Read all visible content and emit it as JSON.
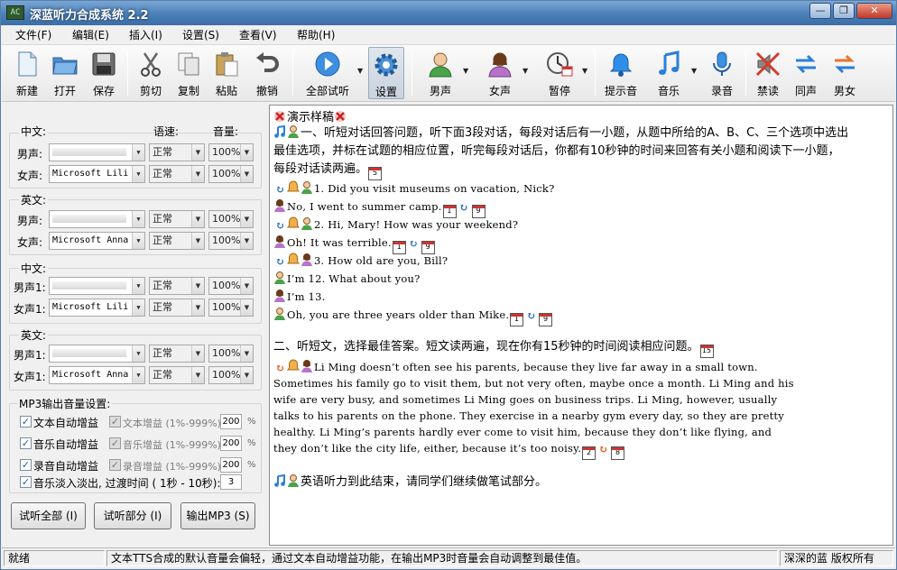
{
  "window": {
    "app_icon_text": "AC",
    "title": "深蓝听力合成系统 2.2",
    "min": "—",
    "max": "❐",
    "close": "✕"
  },
  "menu": [
    "文件(F)",
    "编辑(E)",
    "插入(I)",
    "设置(S)",
    "查看(V)",
    "帮助(H)"
  ],
  "toolbar": {
    "new": "新建",
    "open": "打开",
    "save": "保存",
    "cut": "剪切",
    "copy": "复制",
    "paste": "粘贴",
    "undo": "撤销",
    "play_all": "全部试听",
    "settings": "设置",
    "male": "男声",
    "female": "女声",
    "pause": "暂停",
    "prompt_tone": "提示音",
    "music": "音乐",
    "record": "录音",
    "no_read": "禁读",
    "same_voice": "同声",
    "male_female": "男女"
  },
  "left": {
    "sec1": {
      "title": "中文:",
      "speed": "语速:",
      "volume": "音量:",
      "rows": [
        {
          "label": "男声:",
          "voice": "",
          "speed": "正常",
          "volume": "100%"
        },
        {
          "label": "女声:",
          "voice": "Microsoft Lili",
          "speed": "正常",
          "volume": "100%"
        }
      ]
    },
    "sec2": {
      "title": "英文:",
      "rows": [
        {
          "label": "男声:",
          "voice": "",
          "speed": "正常",
          "volume": "100%"
        },
        {
          "label": "女声:",
          "voice": "Microsoft Anna",
          "speed": "正常",
          "volume": "100%"
        }
      ]
    },
    "sec3": {
      "title": "中文:",
      "rows": [
        {
          "label": "男声1:",
          "voice": "",
          "speed": "正常",
          "volume": "100%"
        },
        {
          "label": "女声1:",
          "voice": "Microsoft Lili",
          "speed": "正常",
          "volume": "100%"
        }
      ]
    },
    "sec4": {
      "title": "英文:",
      "rows": [
        {
          "label": "男声1:",
          "voice": "",
          "speed": "正常",
          "volume": "100%"
        },
        {
          "label": "女声1:",
          "voice": "Microsoft Anna",
          "speed": "正常",
          "volume": "100%"
        }
      ]
    },
    "mp3": {
      "title": "MP3输出音量设置:",
      "text_auto": "文本自动增益",
      "text_gain": "文本增益 (1%-999%)",
      "text_gain_val": "200",
      "music_auto": "音乐自动增益",
      "music_gain": "音乐增益 (1%-999%)",
      "music_gain_val": "200",
      "rec_auto": "录音自动增益",
      "rec_gain": "录音增益 (1%-999%)",
      "rec_gain_val": "200",
      "fade": "音乐淡入淡出, 过渡时间 ( 1秒 - 10秒):",
      "fade_val": "3",
      "pct": "%",
      "checked": "✓"
    },
    "buttons": {
      "play_all": "试听全部 (I)",
      "play_part": "试听部分 (I)",
      "export": "输出MP3 (S)"
    }
  },
  "doc": {
    "title": "演示样稿",
    "p1_a": "一、听短对话回答问题，听下面3段对话，每段对话后有一小题，从题中所给的A、B、C、三个选项中选出",
    "p1_b": "最佳选项，并标在试题的相应位置，听完每段对话后，你都有10秒钟的时间来回答有关小题和阅读下一小题，",
    "p1_c": "每段对话读两遍。",
    "p1_box": "5",
    "d1": "1. Did you visit museums on vacation, Nick?",
    "d2": "No, I went to summer camp.",
    "d3": "2. Hi, Mary! How was your weekend?",
    "d4": "Oh! It was terrible.",
    "d5": "3. How old are you, Bill?",
    "d6": "I’m 12.  What about you?",
    "d7": "I’m 13.",
    "d8": "Oh, you are three years older than Mike.",
    "box1": "1",
    "box9": "9",
    "loop": "↻",
    "p2": "二、听短文，选择最佳答案。短文读两遍，现在你有15秒钟的时间阅读相应问题。",
    "p2_box": "15",
    "t1": "Li Ming doesn’t often see his parents, because they live far away in a small town.",
    "t2": "Sometimes his family go to visit them, but not very often, maybe once a month.  Li Ming and his",
    "t3": "wife are very busy, and sometimes Li Ming goes on business trips.  Li Ming, however, usually",
    "t4": "talks to his parents on the phone.  They exercise in a nearby gym every day, so they are pretty",
    "t5": "healthy.  Li Ming’s parents hardly ever come to visit him, because they don’t like flying, and",
    "t6": "they don’t like the city life, either, because it’s too noisy.",
    "t_box2": "2",
    "t_box8": "8",
    "end": "英语听力到此结束，请同学们继续做笔试部分。"
  },
  "status": {
    "ready": "就绪",
    "message": "文本TTS合成的默认音量会偏轻，通过文本自动增益功能，在输出MP3时音量会自动调整到最佳值。",
    "copyright": "深深的蓝 版权所有"
  }
}
